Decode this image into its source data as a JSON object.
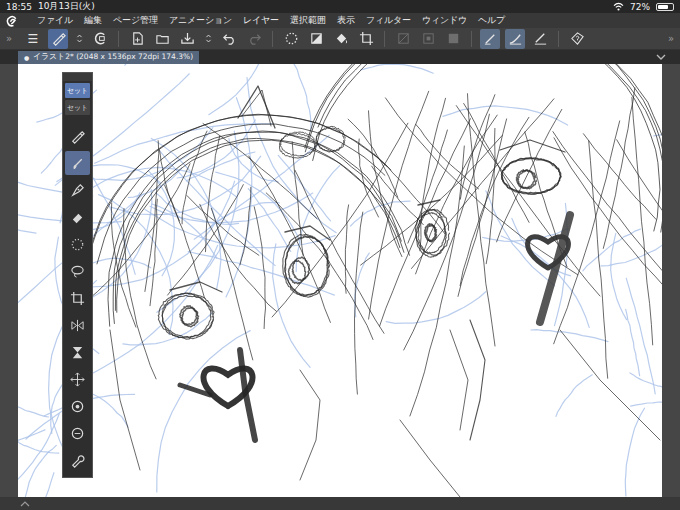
{
  "status_bar": {
    "time": "18:55",
    "date": "10月13日(火)",
    "battery": "72%",
    "battery_level": 0.72
  },
  "menu_bar": {
    "items": [
      "ファイル",
      "編集",
      "ページ管理",
      "アニメーション",
      "レイヤー",
      "選択範囲",
      "表示",
      "フィルター",
      "ウィンドウ",
      "ヘルプ"
    ]
  },
  "toolbar": {
    "left_arrow": "»",
    "right_arrow": "»",
    "groups": [
      [
        {
          "kind": "menu",
          "label": "☰",
          "selected": false,
          "disabled": false
        },
        {
          "kind": "pen",
          "selected": true,
          "disabled": false
        },
        {
          "kind": "spinner",
          "selected": false,
          "disabled": false
        },
        {
          "kind": "layer",
          "selected": false,
          "disabled": false
        }
      ],
      [
        {
          "kind": "new",
          "selected": false,
          "disabled": false
        },
        {
          "kind": "open",
          "selected": false,
          "disabled": false
        },
        {
          "kind": "save",
          "selected": false,
          "disabled": false
        },
        {
          "kind": "spinner",
          "selected": false,
          "disabled": false
        },
        {
          "kind": "undo",
          "selected": false,
          "disabled": false
        },
        {
          "kind": "redo",
          "selected": false,
          "disabled": true
        }
      ],
      [
        {
          "kind": "deselect",
          "selected": false,
          "disabled": false
        },
        {
          "kind": "clear",
          "selected": false,
          "disabled": false
        },
        {
          "kind": "fill",
          "selected": false,
          "disabled": false
        },
        {
          "kind": "crop",
          "selected": false,
          "disabled": false
        }
      ],
      [
        {
          "kind": "slash",
          "selected": false,
          "disabled": true
        },
        {
          "kind": "invert",
          "selected": false,
          "disabled": true
        },
        {
          "kind": "square",
          "selected": false,
          "disabled": true
        }
      ],
      [
        {
          "kind": "stabilize",
          "selected": true,
          "disabled": false
        },
        {
          "kind": "curve",
          "selected": true,
          "disabled": false
        },
        {
          "kind": "ruler",
          "selected": false,
          "disabled": false
        }
      ],
      [
        {
          "kind": "help",
          "selected": false,
          "disabled": false
        }
      ]
    ]
  },
  "document_tab": {
    "marker": "●",
    "label": "イラスト2* (2048 x 1536px 72dpi 174.3%)",
    "selected": true
  },
  "tool_palette": {
    "sets": [
      {
        "label": "セット",
        "selected": true
      },
      {
        "label": "セット",
        "selected": false
      }
    ],
    "tools": [
      {
        "kind": "pen",
        "selected": false
      },
      {
        "kind": "brush",
        "selected": true
      },
      {
        "kind": "nib",
        "selected": false
      },
      {
        "kind": "eraser",
        "selected": false
      },
      {
        "kind": "dots",
        "selected": false
      },
      {
        "kind": "lasso",
        "selected": false
      },
      {
        "kind": "crop",
        "selected": false
      },
      {
        "kind": "mirror",
        "selected": false
      },
      {
        "kind": "hourglass",
        "selected": false
      },
      {
        "kind": "move",
        "selected": false
      },
      {
        "kind": "ring",
        "selected": false
      },
      {
        "kind": "ring2",
        "selected": false
      },
      {
        "kind": "wrench",
        "selected": false
      }
    ]
  }
}
